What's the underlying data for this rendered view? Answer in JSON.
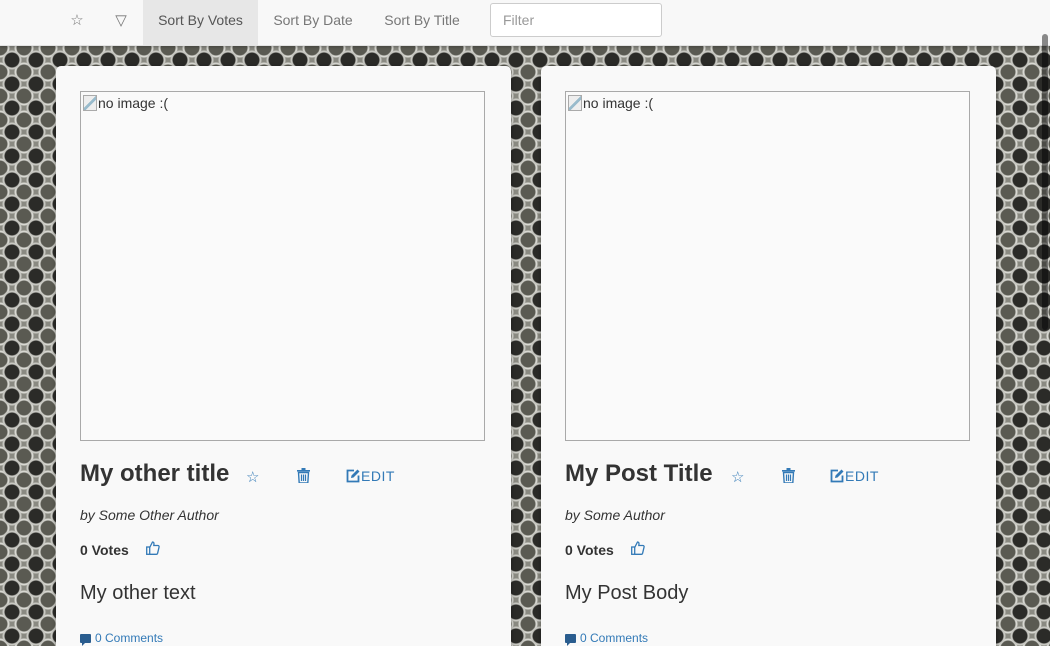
{
  "toolbar": {
    "star_icon": "☆",
    "filter_icon": "▽",
    "sort_options": [
      "Sort By Votes",
      "Sort By Date",
      "Sort By Title"
    ],
    "active_sort": "Sort By Votes",
    "filter_placeholder": "Filter"
  },
  "colors": {
    "link": "#337ab7",
    "text": "#333333",
    "nav_active_bg": "#e7e7e7"
  },
  "posts": [
    {
      "image_alt": "no image :(",
      "title": "My other title",
      "star_icon": "☆",
      "delete_icon": "trash-icon",
      "edit_label": "EDIT",
      "author": "by Some Other Author",
      "votes": "0 Votes",
      "upvote_icon": "thumbs-up-icon",
      "body": "My other text",
      "comments": "0 Comments"
    },
    {
      "image_alt": "no image :(",
      "title": "My Post Title",
      "star_icon": "☆",
      "delete_icon": "trash-icon",
      "edit_label": "EDIT",
      "author": "by Some Author",
      "votes": "0 Votes",
      "upvote_icon": "thumbs-up-icon",
      "body": "My Post Body",
      "comments": "0 Comments"
    }
  ]
}
